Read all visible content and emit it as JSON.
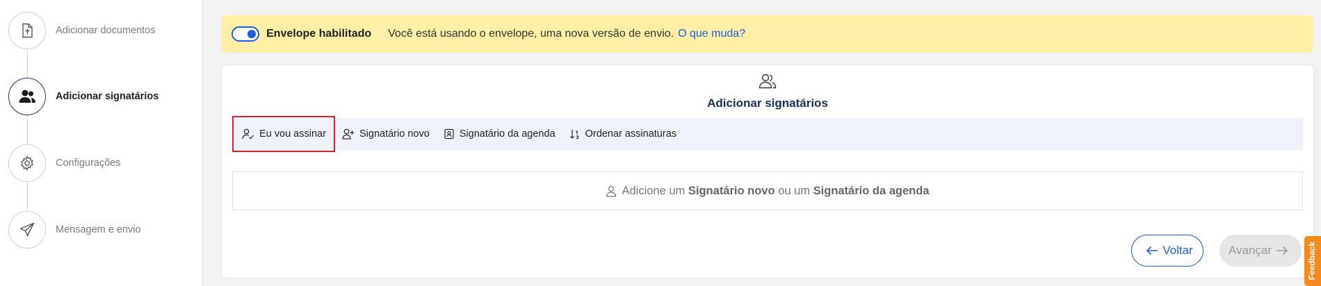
{
  "sidebar": {
    "steps": [
      {
        "label": "Adicionar documentos",
        "icon": "document-upload-icon",
        "state": "done"
      },
      {
        "label": "Adicionar signatários",
        "icon": "users-icon",
        "state": "active"
      },
      {
        "label": "Configurações",
        "icon": "gear-icon",
        "state": "pending"
      },
      {
        "label": "Mensagem e envio",
        "icon": "paper-plane-icon",
        "state": "pending"
      }
    ]
  },
  "banner": {
    "title": "Envelope habilitado",
    "text": "Você está usando o envelope, uma nova versão de envio.",
    "link": "O que muda?",
    "toggle_on": true
  },
  "card": {
    "icon": "users-icon",
    "title": "Adicionar signatários",
    "toolbar": [
      {
        "label": "Eu vou assinar",
        "icon": "user-check-icon"
      },
      {
        "label": "Signatário novo",
        "icon": "user-plus-icon"
      },
      {
        "label": "Signatário da agenda",
        "icon": "address-book-icon"
      },
      {
        "label": "Ordenar assinaturas",
        "icon": "sort-order-icon"
      }
    ],
    "empty": {
      "prefix": "Adicione um",
      "bold1": "Signatário novo",
      "middle": "ou um",
      "bold2": "Signatário da agenda"
    }
  },
  "buttons": {
    "back": "Voltar",
    "next": "Avançar"
  },
  "feedback": "Feedback",
  "colors": {
    "accent": "#1f5ee0",
    "banner_bg": "#fdf0a6",
    "title_navy": "#16305b",
    "highlight": "#e01e26",
    "feedback": "#f28a1f"
  }
}
